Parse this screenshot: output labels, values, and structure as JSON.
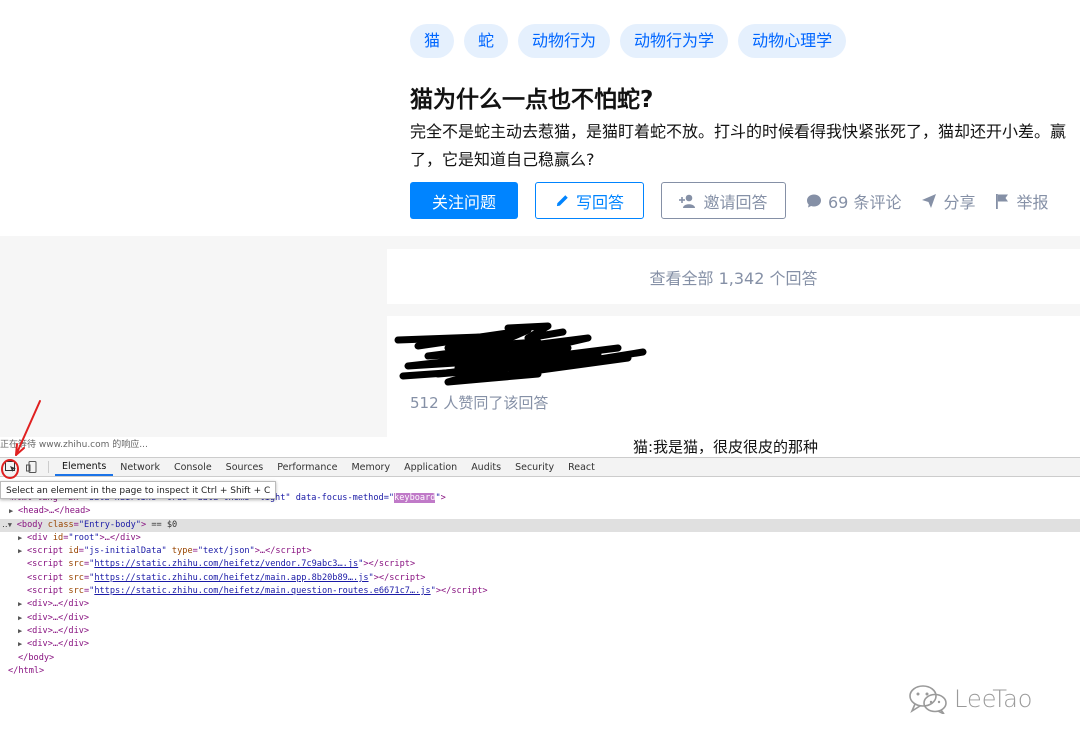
{
  "topics": [
    "猫",
    "蛇",
    "动物行为",
    "动物行为学",
    "动物心理学"
  ],
  "question": {
    "title": "猫为什么一点也不怕蛇?",
    "detail": "完全不是蛇主动去惹猫，是猫盯着蛇不放。打斗的时候看得我快紧张死了，猫却还开小差。赢了，它是知道自己稳赢么?"
  },
  "actions": {
    "follow": "关注问题",
    "write_answer": "写回答",
    "invite": "邀请回答",
    "comments": "69 条评论",
    "share": "分享",
    "report": "举报"
  },
  "view_all": "查看全部 1,342 个回答",
  "answer": {
    "upvotes": "512 人赞同了该回答",
    "first_line": "猫:我是猫，很皮很皮的那种"
  },
  "devtools": {
    "status": "正在等待 www.zhihu.com 的响应...",
    "tabs": [
      "Elements",
      "Network",
      "Console",
      "Sources",
      "Performance",
      "Memory",
      "Application",
      "Audits",
      "Security",
      "React"
    ],
    "active_tab": "Elements",
    "tooltip": "Select an element in the page to inspect it  Ctrl + Shift + C",
    "html_attrs_tail": "\" data-hairline=\"true\" data-theme=\"light\" data-focus-method=\"",
    "html_prefix": "<html lang=\"zh",
    "focus_method_value": "keyboard",
    "head": "<head>…</head>",
    "body_class": "Entry-body",
    "body_suffix": " == $0",
    "root_div": "\"root\"",
    "script1_id": "\"js-initialData\"",
    "script1_type": "\"text/json\"",
    "script_srcs": [
      "https://static.zhihu.com/heifetz/vendor.7c9abc3….js",
      "https://static.zhihu.com/heifetz/main.app.8b20b89….js",
      "https://static.zhihu.com/heifetz/main.question-routes.e6671c7….js"
    ],
    "div_collapsed": "<div>…</div>",
    "body_close": "</body>",
    "html_close": "</html>"
  },
  "watermark": "LeeTao",
  "colors": {
    "zhihu_blue": "#0084ff",
    "topic_bg": "#e5f0fd",
    "meta_gray": "#8590a6",
    "annotation_red": "#e02020"
  }
}
